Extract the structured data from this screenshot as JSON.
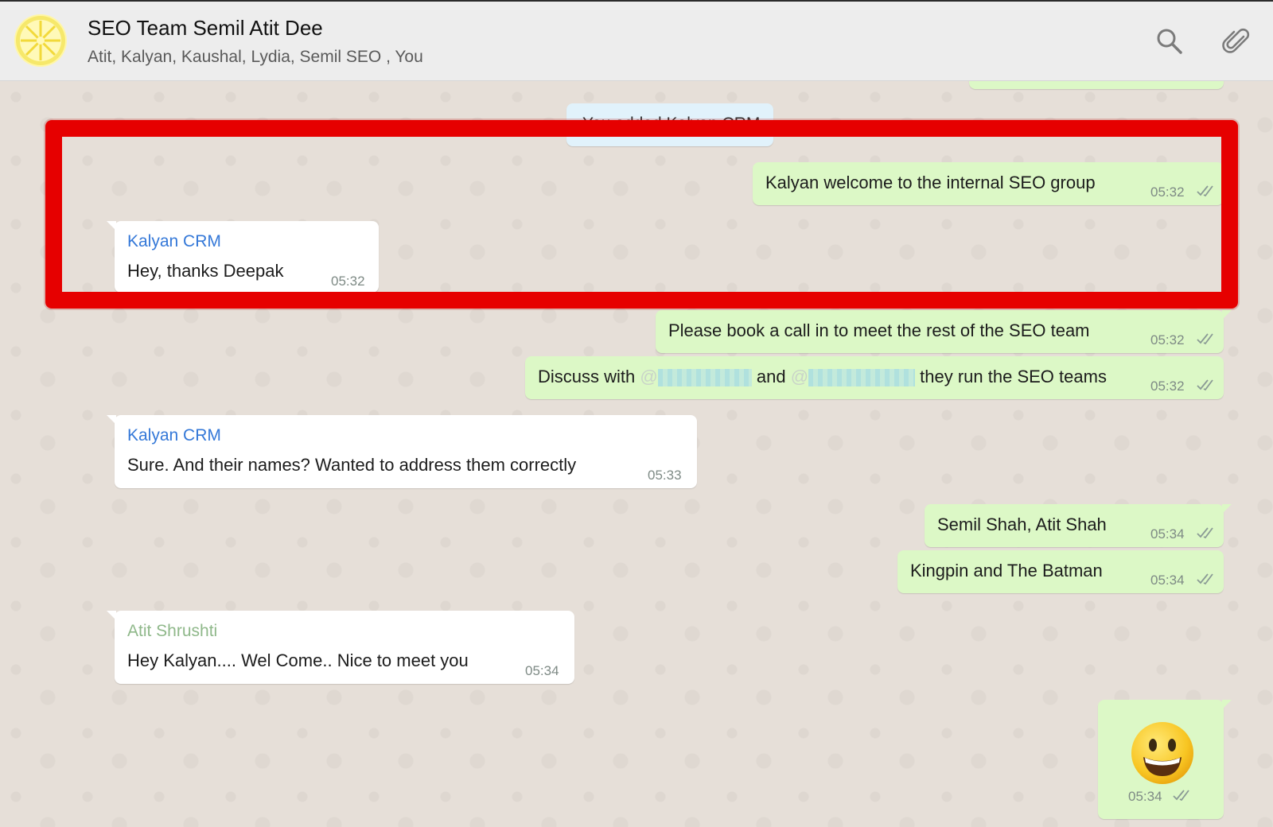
{
  "header": {
    "title": "SEO Team Semil Atit Dee",
    "participants": "Atit, Kalyan, Kaushal, Lydia, Semil SEO , You"
  },
  "icons": {
    "avatar": "lemon-slice-icon",
    "search": "search-icon",
    "attach": "paperclip-icon",
    "read_receipt": "double-check-icon",
    "emoji": "grinning-face-icon"
  },
  "colors": {
    "outgoing_bubble": "#dcf8c6",
    "incoming_bubble": "#ffffff",
    "sender_kalyan": "#3478d8",
    "sender_atit": "#8fb88a",
    "highlight_border": "#e60000"
  },
  "messages": [
    {
      "kind": "system",
      "text": "You added Kalyan CRM"
    },
    {
      "kind": "out",
      "text": "Kalyan welcome to the internal SEO group",
      "time": "05:32"
    },
    {
      "kind": "in",
      "sender": "Kalyan CRM",
      "text": "Hey, thanks Deepak",
      "time": "05:32"
    },
    {
      "kind": "out",
      "text": "Please book a call in to meet the rest of the SEO team",
      "time": "05:32"
    },
    {
      "kind": "out",
      "text_start": "Discuss with",
      "text_and": "and",
      "text_end": "they run the SEO teams",
      "mention_prefix": "@",
      "time": "05:32"
    },
    {
      "kind": "in",
      "sender": "Kalyan CRM",
      "text": "Sure. And their names? Wanted to address them correctly",
      "time": "05:33"
    },
    {
      "kind": "out",
      "text": "Semil Shah, Atit Shah",
      "time": "05:34"
    },
    {
      "kind": "out",
      "text": "Kingpin and The Batman",
      "time": "05:34"
    },
    {
      "kind": "in",
      "sender": "Atit Shrushti",
      "text": "Hey Kalyan.... Wel Come.. Nice to meet you",
      "time": "05:34"
    },
    {
      "kind": "out",
      "emoji": "grinning-face",
      "time": "05:34"
    }
  ]
}
